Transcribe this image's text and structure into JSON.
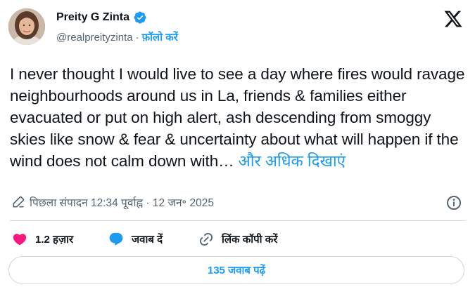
{
  "author": {
    "display_name": "Preity G Zinta",
    "handle": "@realpreityzinta",
    "separator": "·",
    "follow_label": "फ़ॉलो करें",
    "avatar_icon": "profile-photo",
    "verified_icon": "verified-badge-icon"
  },
  "tweet": {
    "text": "I never thought I would live to see a day where fires would ravage neighbourhoods around us in La, friends & families either evacuated or put on high alert, ash descending from smoggy skies like snow & fear & uncertainty about what will happen if the wind does not calm down with…",
    "show_more_label": "और अधिक दिखाएं"
  },
  "meta": {
    "edited_label": "पिछला संपादन 12:34 पूर्वाह्न · 12 जन॰ 2025",
    "edit_icon": "pencil-icon",
    "info_icon": "info-icon"
  },
  "actions": {
    "like_count": "1.2 हज़ार",
    "reply_label": "जवाब दें",
    "copy_link_label": "लिंक कॉपी करें"
  },
  "replies_button_label": "135 जवाब पढ़ें",
  "colors": {
    "accent": "#1d9bf0",
    "like": "#f91880",
    "text": "#0f1419",
    "muted": "#536471",
    "border": "#cfd9de"
  }
}
